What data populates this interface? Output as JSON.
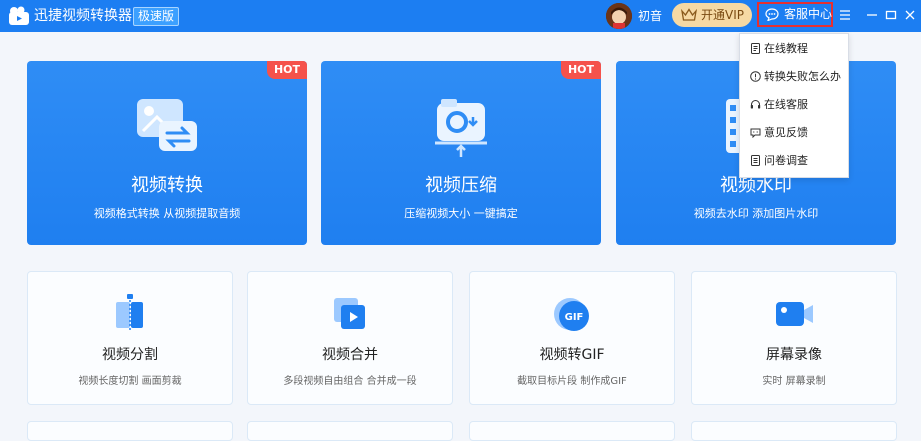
{
  "titlebar": {
    "app_title": "迅捷视频转换器",
    "edition_badge": "极速版",
    "username": "初音",
    "vip_label": "开通VIP",
    "service_label": "客服中心",
    "accent_color": "#1c7ef2"
  },
  "feature_cards": [
    {
      "title": "视频转换",
      "subtitle": "视频格式转换 从视频提取音频",
      "badge": "HOT",
      "icon": "video-convert-icon"
    },
    {
      "title": "视频压缩",
      "subtitle": "压缩视频大小 一键搞定",
      "badge": "HOT",
      "icon": "video-compress-icon"
    },
    {
      "title": "视频水印",
      "subtitle": "视频去水印 添加图片水印",
      "icon": "video-watermark-icon"
    }
  ],
  "tool_cards": [
    {
      "title": "视频分割",
      "subtitle": "视频长度切割 画面剪裁",
      "icon": "video-split-icon"
    },
    {
      "title": "视频合并",
      "subtitle": "多段视频自由组合 合并成一段",
      "icon": "video-merge-icon"
    },
    {
      "title": "视频转GIF",
      "subtitle": "截取目标片段 制作成GIF",
      "icon": "video-to-gif-icon"
    },
    {
      "title": "屏幕录像",
      "subtitle": "实时 屏幕录制",
      "icon": "screen-record-icon"
    }
  ],
  "dropdown": {
    "items": [
      {
        "label": "在线教程",
        "icon": "document-icon"
      },
      {
        "label": "转换失败怎么办",
        "icon": "info-icon"
      },
      {
        "label": "在线客服",
        "icon": "headset-icon"
      },
      {
        "label": "意见反馈",
        "icon": "chat-bubble-icon"
      },
      {
        "label": "问卷调查",
        "icon": "questionnaire-icon"
      }
    ]
  },
  "icons": {
    "gif_text": "GIF"
  }
}
